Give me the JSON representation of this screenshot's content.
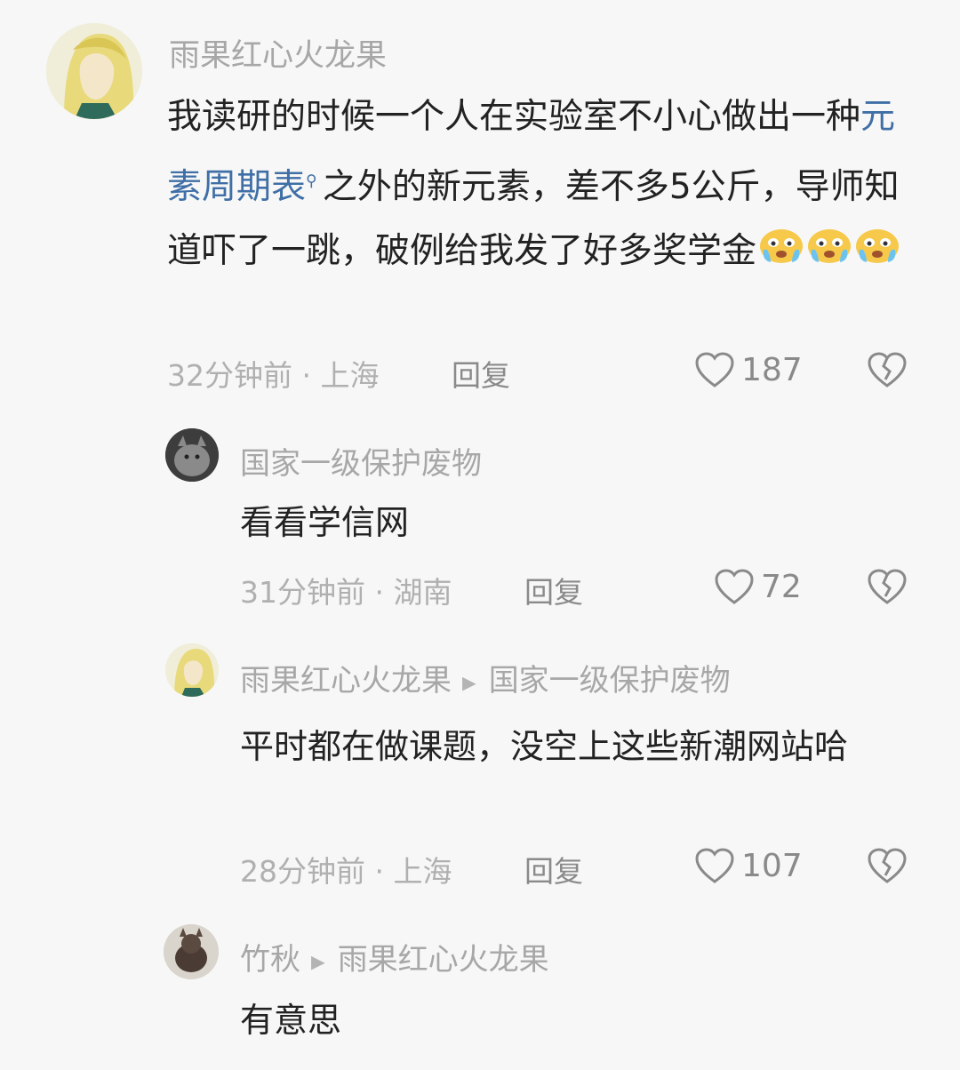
{
  "comments": [
    {
      "user": "雨果红心火龙果",
      "text_pre": "我读研的时候一个人在实验室不小心做出一种",
      "link": "元素周期表",
      "text_post": "之外的新元素，差不多5公斤，导师知道吓了一跳，破例给我发了好多奖学金",
      "time": "32分钟前",
      "location": "上海",
      "reply_label": "回复",
      "likes": "187",
      "emoji_count": 3
    },
    {
      "user": "国家一级保护废物",
      "text": "看看学信网",
      "time": "31分钟前",
      "location": "湖南",
      "reply_label": "回复",
      "likes": "72"
    },
    {
      "user": "雨果红心火龙果",
      "reply_to": "国家一级保护废物",
      "text": "平时都在做课题，没空上这些新潮网站哈",
      "time": "28分钟前",
      "location": "上海",
      "reply_label": "回复",
      "likes": "107"
    },
    {
      "user": "竹秋",
      "reply_to": "雨果红心火龙果",
      "text": "有意思"
    }
  ],
  "meta_separator": " · ",
  "colors": {
    "link": "#3f6fa6",
    "name": "#a7a7a7",
    "meta": "#b0b0b0",
    "action": "#8a8a8a"
  },
  "icons": [
    "heart-outline-icon",
    "broken-heart-icon",
    "search-icon",
    "crying-emoji"
  ]
}
